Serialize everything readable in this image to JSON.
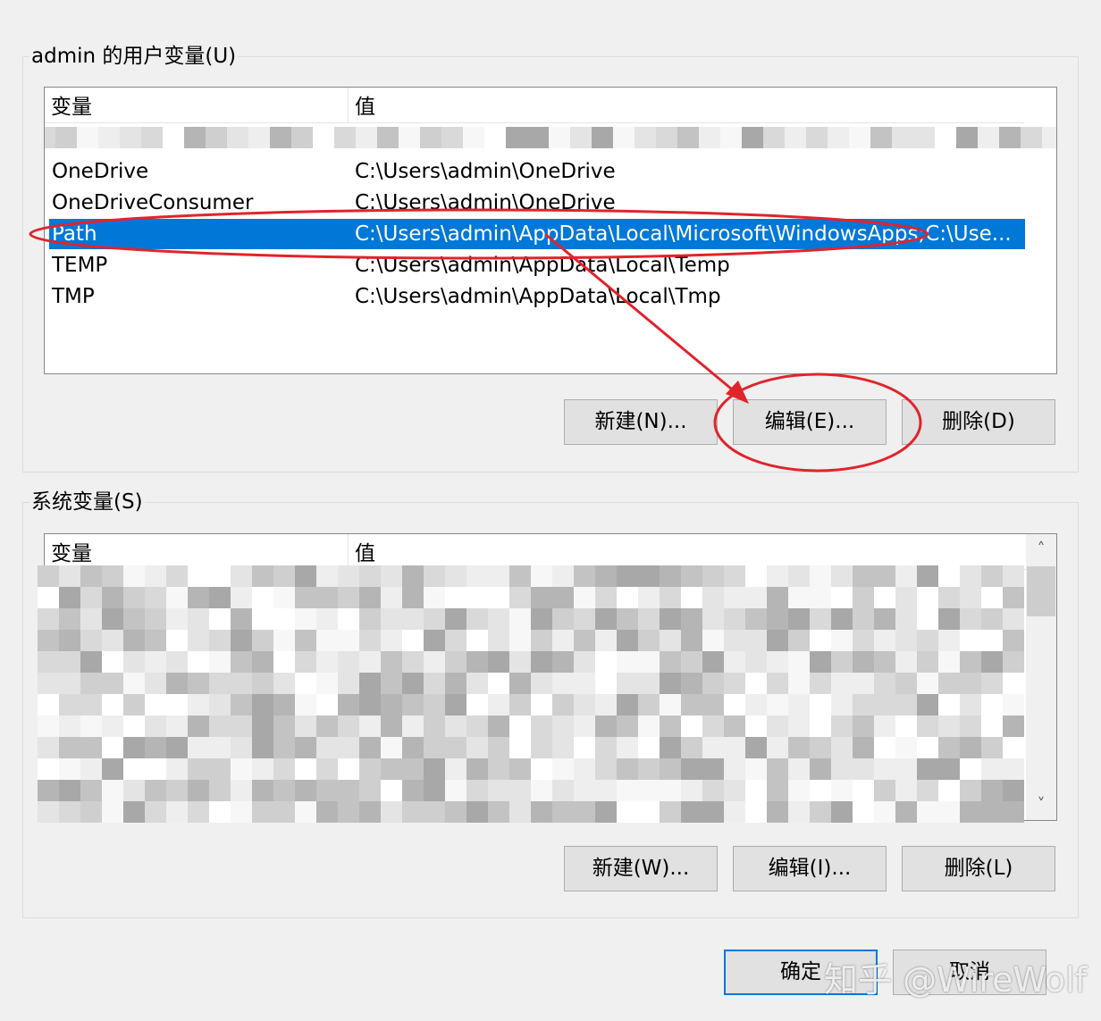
{
  "user_vars": {
    "title": "admin 的用户变量(U)",
    "col_var": "变量",
    "col_val": "值",
    "rows": [
      {
        "name": "OneDrive",
        "value": "C:\\Users\\admin\\OneDrive"
      },
      {
        "name": "OneDriveConsumer",
        "value": "C:\\Users\\admin\\OneDrive"
      },
      {
        "name": "Path",
        "value": "C:\\Users\\admin\\AppData\\Local\\Microsoft\\WindowsApps;C:\\Use..."
      },
      {
        "name": "TEMP",
        "value": "C:\\Users\\admin\\AppData\\Local\\Temp"
      },
      {
        "name": "TMP",
        "value": "C:\\Users\\admin\\AppData\\Local\\Tmp"
      }
    ],
    "selected_row": "Path",
    "new_label": "新建(N)...",
    "edit_label": "编辑(E)...",
    "delete_label": "删除(D)"
  },
  "system_vars": {
    "title": "系统变量(S)",
    "col_var": "变量",
    "col_val": "值",
    "new_label": "新建(W)...",
    "edit_label": "编辑(I)...",
    "delete_label": "删除(L)"
  },
  "dialog": {
    "ok_label": "确定",
    "cancel_label": "取消"
  },
  "watermark": "知乎 @WireWolf",
  "colors": {
    "selection": "#0078d7",
    "annotation": "#e0242c",
    "background": "#f0f0f0"
  },
  "icons": {
    "scroll_up": "chevron-up-icon",
    "scroll_down": "chevron-down-icon"
  }
}
